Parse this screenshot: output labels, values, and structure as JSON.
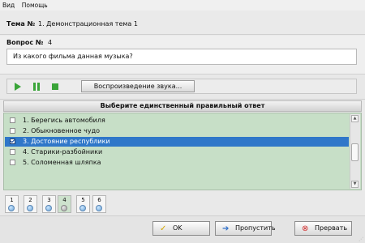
{
  "menu": {
    "items": [
      "Вид",
      "Помощь"
    ]
  },
  "topic": {
    "label": "Тема №",
    "value": "1. Демонстрационная тема 1"
  },
  "question": {
    "label": "Вопрос №",
    "number": "4",
    "text": "Из какого фильма данная музыка?"
  },
  "player": {
    "sound_button": "Воспроизведение звука...",
    "icons": [
      "play-icon",
      "pause-icon",
      "stop-icon"
    ],
    "icon_color": "#3aa539"
  },
  "answers": {
    "header": "Выберите единственный правильный ответ",
    "items": [
      {
        "label": "1. Берегись автомобиля",
        "checked": false
      },
      {
        "label": "2. Обыкновенное чудо",
        "checked": false
      },
      {
        "label": "3. Достояние республики",
        "checked": true
      },
      {
        "label": "4. Старики-разбойники",
        "checked": false
      },
      {
        "label": "5. Соломенная шляпка",
        "checked": false
      }
    ],
    "selected_color": "#2f77c9",
    "list_bg": "#c7dfc7"
  },
  "qnav": {
    "numbers": [
      "1",
      "2",
      "3",
      "4",
      "5",
      "6"
    ],
    "current": "4"
  },
  "buttons": {
    "ok": "OK",
    "ok_icon": "check-icon",
    "skip": "Пропустить",
    "skip_icon": "arrow-right-icon",
    "stop": "Прервать",
    "stop_icon": "stop-circle-icon"
  }
}
